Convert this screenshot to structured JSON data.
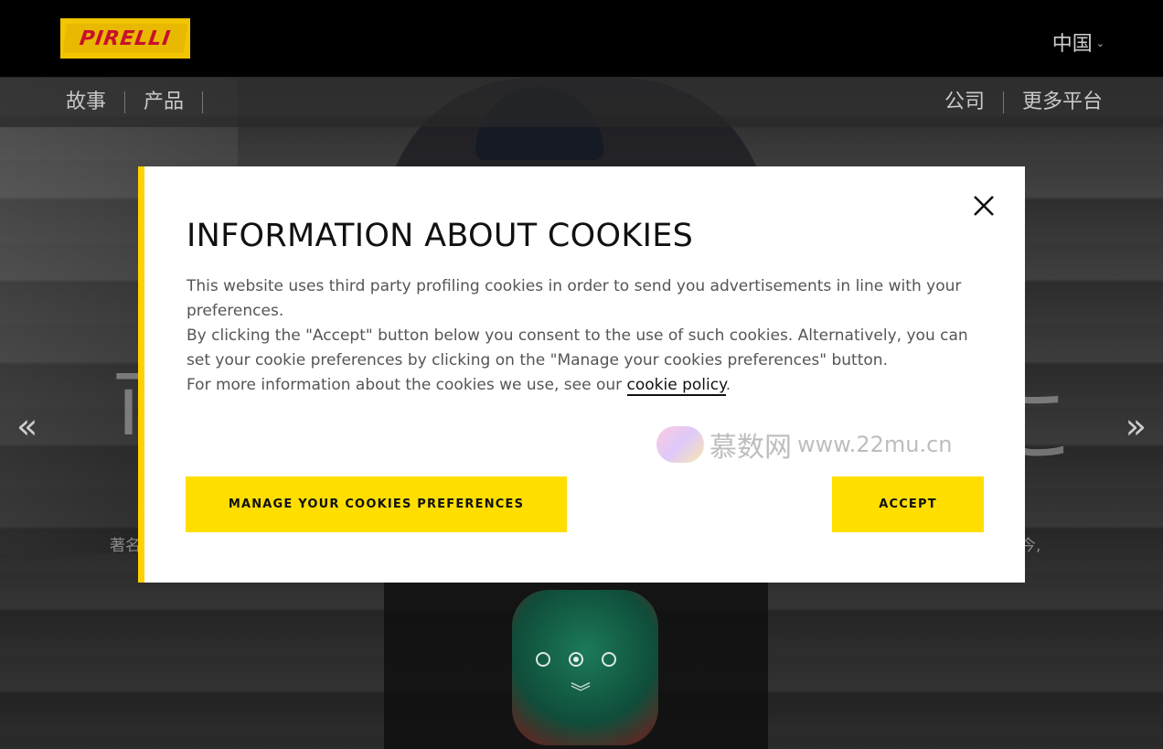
{
  "header": {
    "logo_text": "PIRELLI",
    "country_label": "中国"
  },
  "subnav": {
    "left_items": [
      "故事",
      "产品"
    ],
    "right_items": [
      "公司",
      "更多平台"
    ]
  },
  "hero": {
    "title_left_fragment": "ī",
    "title_right_fragment": "こ",
    "subtitle_left_fragment": "著名",
    "subtitle_right_fragment": "今,",
    "prev_arrow": "«",
    "next_arrow": "»",
    "scroll_down": "︾",
    "slides_count": 3,
    "active_slide": 2
  },
  "cookie_modal": {
    "title": "INFORMATION ABOUT COOKIES",
    "paragraph_1": "This website uses third party profiling cookies in order to send you advertisements in line with your preferences.",
    "paragraph_2": "By clicking the \"Accept\" button below you consent to the use of such cookies. Alternatively, you can set your cookie preferences by clicking on the \"Manage your cookies preferences\" button.",
    "paragraph_3_prefix": "For more information about the cookies we use, see our ",
    "policy_link": "cookie policy",
    "paragraph_3_suffix": ".",
    "manage_button": "MANAGE YOUR COOKIES PREFERENCES",
    "accept_button": "ACCEPT",
    "close_icon": "close-icon",
    "accent_color": "#ffd200"
  },
  "watermark": {
    "name": "慕数网",
    "url": "www.22mu.cn"
  }
}
